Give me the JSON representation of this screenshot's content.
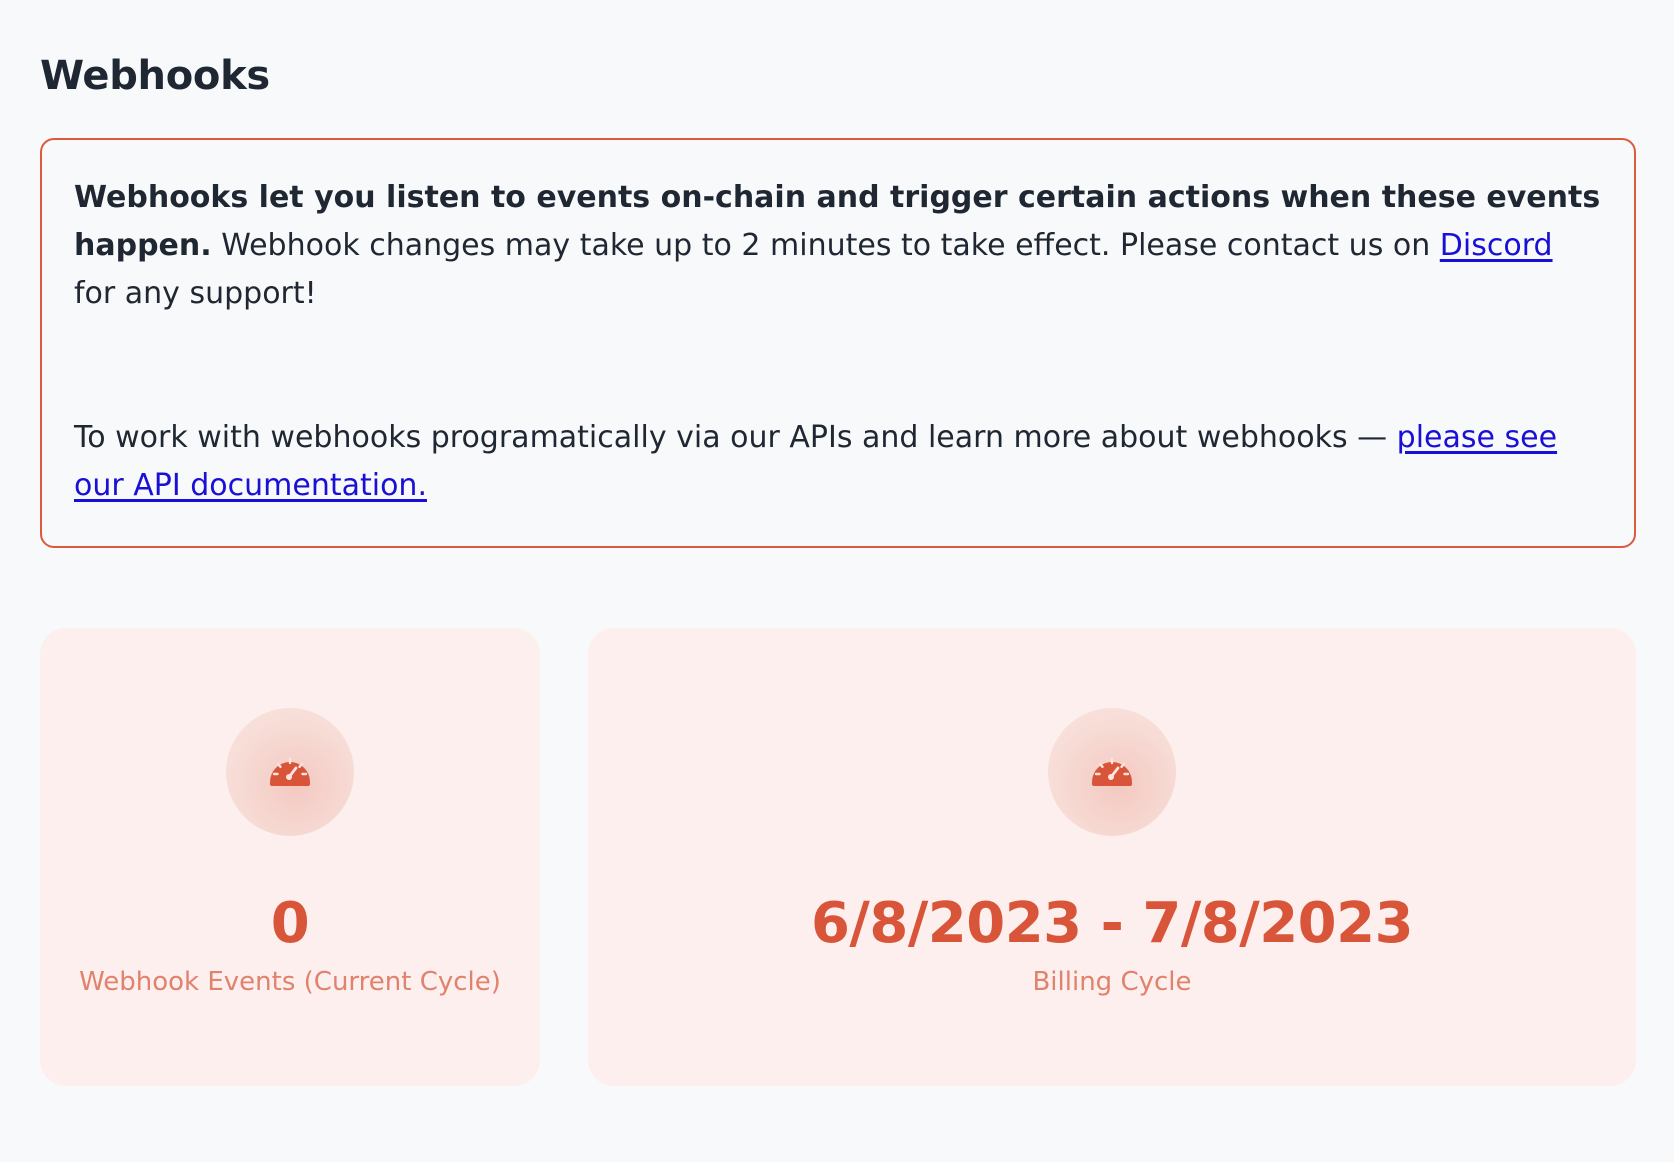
{
  "header": {
    "title": "Webhooks"
  },
  "info": {
    "intro_bold": "Webhooks let you listen to events on-chain and trigger certain actions when these events happen.",
    "intro_text": " Webhook changes may take up to 2 minutes to take effect. Please contact us on ",
    "discord_link": "Discord",
    "intro_tail": " for any support!",
    "api_text": "To work with webhooks programatically via our APIs and learn more about webhooks — ",
    "api_link": "please see our API documentation."
  },
  "stats": {
    "events": {
      "value": "0",
      "label": "Webhook Events (Current Cycle)",
      "icon": "gauge-icon"
    },
    "billing": {
      "value": "6/8/2023 - 7/8/2023",
      "label": "Billing Cycle",
      "icon": "gauge-icon"
    }
  },
  "colors": {
    "accent": "#d9553a",
    "accent_light": "#e0826c",
    "card_bg": "#fcefee",
    "border": "#dc5a3e",
    "link": "#1a0fd6"
  }
}
